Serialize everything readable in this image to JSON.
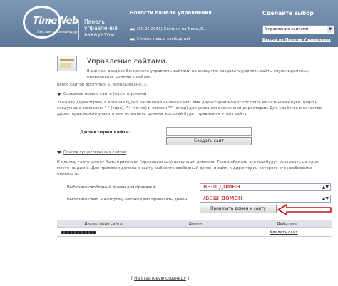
{
  "header": {
    "logo": "TimeWeb",
    "logo_sub": "Хостинг провайдер",
    "tagline_lines": [
      "Панель",
      "управления",
      "аккаунтом"
    ],
    "news_title": "Новости панели управления",
    "news_items": [
      {
        "date": "(30.05.2011)",
        "text": "Хостинг на Node.JS..."
      },
      {
        "date": "",
        "text": "Список новых сообщений"
      }
    ],
    "choice_title": "Сделайте выбор",
    "choice_value": "Управление сайтами",
    "logout": "Выход из Панели Управления"
  },
  "content": {
    "title": "Управление сайтами.",
    "intro": "В данном разделе Вы можете управлять сайтами на аккаунте: создавать/удалять сайты (мультидомены), привязывать домены к сайтам.",
    "sites_count": "Всего сайтов доступно: 5, использовано: 3.",
    "create_section": "Создание нового сайта (мультидомена)",
    "create_desc": "Укажите директорию, в которой будет расположен новый сайт. Имя директории может состоять из латинских букв, цифр и следующих символов: \"-\" (тире), \".\" (точка) и символ \"/\" (слэш) для указания вложенной директории. Для удобства в качестве директории можно указать имя основного домена, который будет привязан к этому сайту.",
    "dir_label": "Директория сайта:",
    "create_button": "Создать сайт",
    "list_section": "Список существующих сайтов",
    "list_desc": "К одному сайту может быть привязано (прилинковано) несколько доменов. Таким образом все они будут указывать на одно место на диске. Для привязки домена к сайту выберите свободный домен и сайт, к директории которого его необходимо привязать.",
    "free_domain_label": "Выберите свободный домен для привязки:",
    "free_domain_value": "ваш домен",
    "site_label": "Выберите сайт, к которому необходимо привязать домен:",
    "site_value": "/ваш домен",
    "bind_button": "Привязать домен к сайту",
    "table": {
      "headers": [
        "Директория сайта",
        "Домен",
        "Действие"
      ],
      "row_action": "Удалить сайт"
    },
    "home_link_open": "[ ",
    "home_link": "На стартовую страницу",
    "home_link_close": " ]"
  },
  "colors": {
    "header_bg": "#6b84a4",
    "annotation_red": "#c4161c"
  }
}
